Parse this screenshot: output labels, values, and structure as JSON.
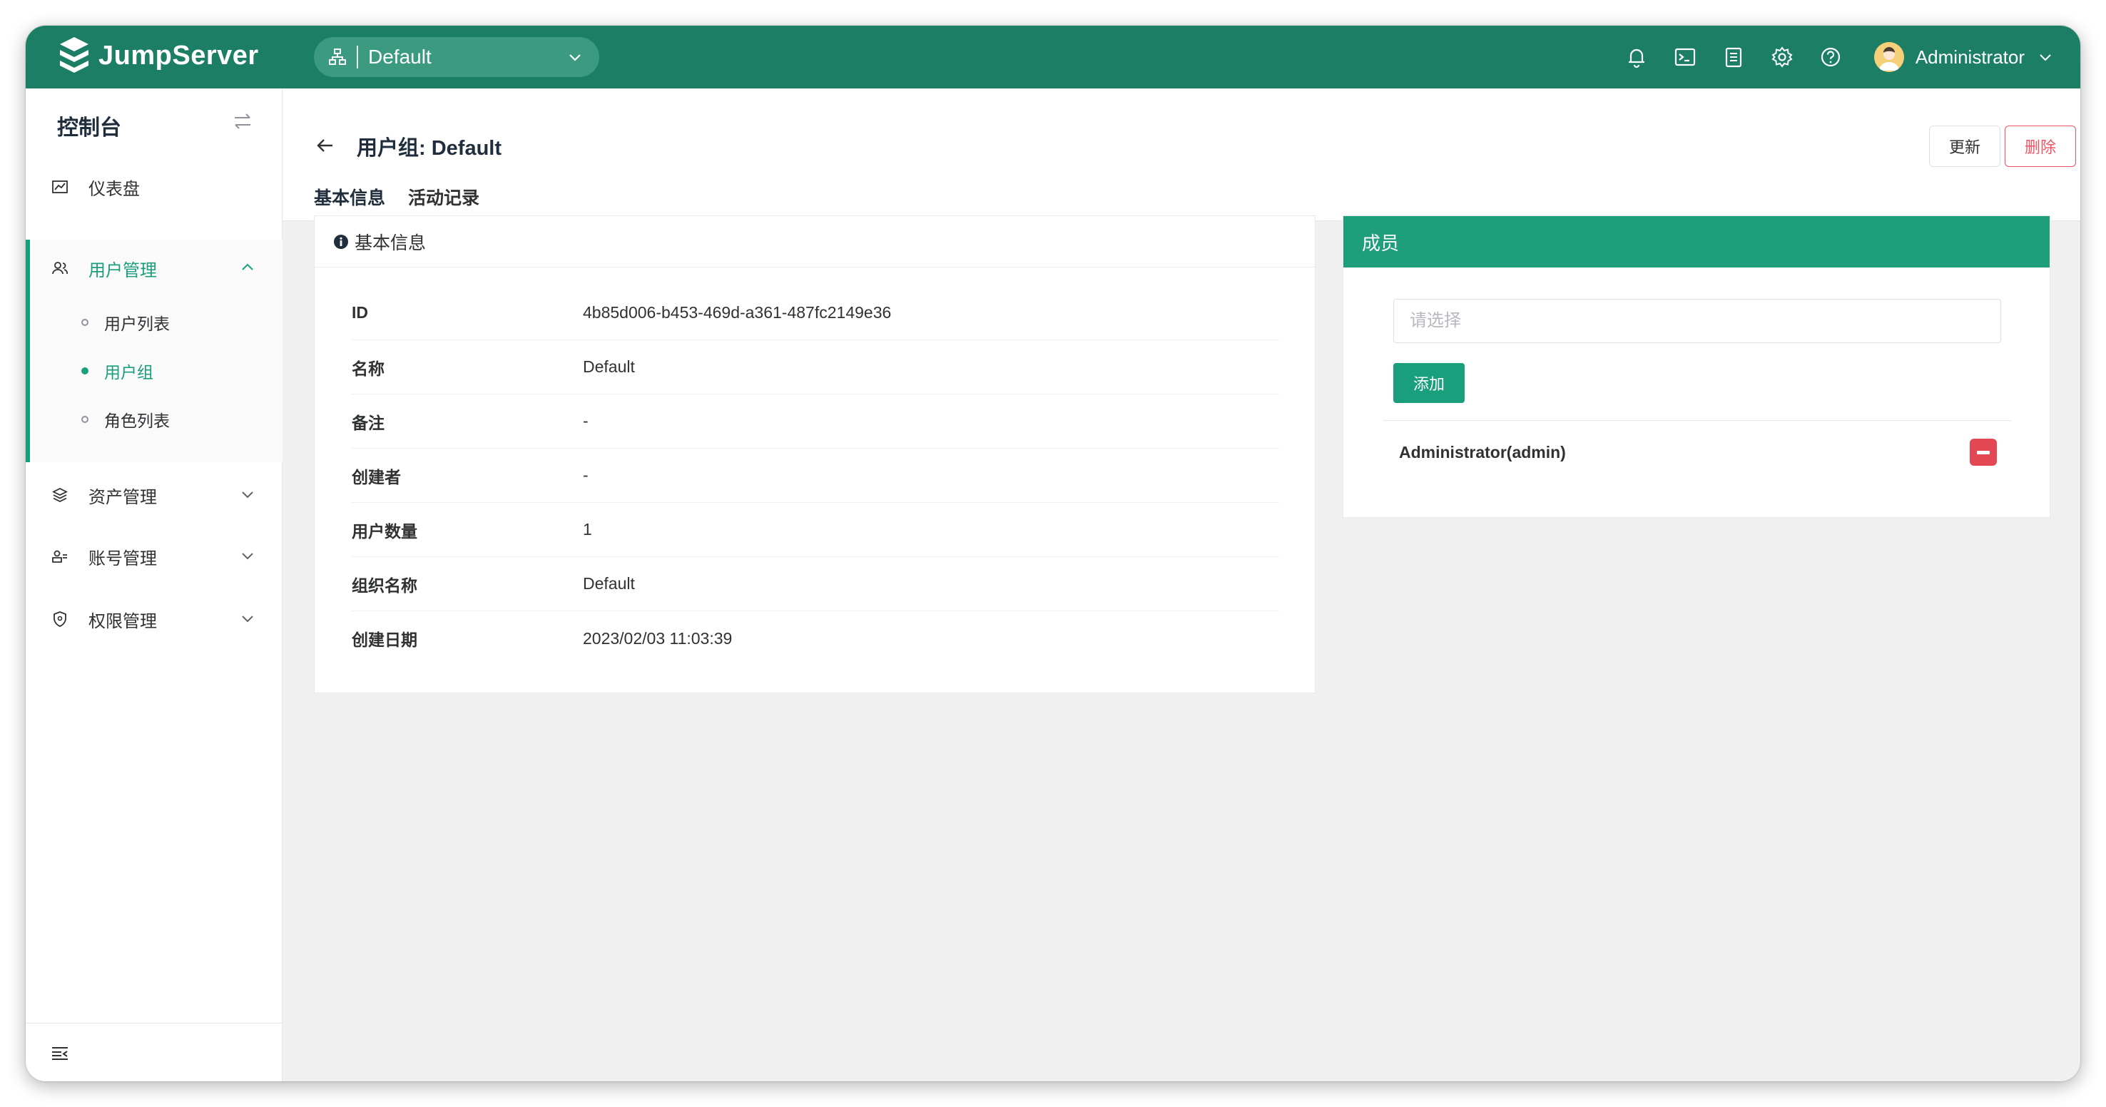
{
  "app": {
    "name": "JumpServer",
    "org_select": {
      "value": "Default"
    },
    "user": {
      "name": "Administrator"
    },
    "colors": {
      "primary": "#1c7f65",
      "accent": "#1a9f7c",
      "danger": "#ed5565"
    },
    "top_icons": [
      "bell-icon",
      "terminal-icon",
      "clipboard-icon",
      "gear-icon",
      "help-icon"
    ]
  },
  "sidebar": {
    "title": "控制台",
    "items": [
      {
        "label": "仪表盘",
        "icon": "dashboard-icon"
      },
      {
        "label": "用户管理",
        "icon": "users-icon",
        "expanded": true,
        "children": [
          {
            "label": "用户列表"
          },
          {
            "label": "用户组",
            "active": true
          },
          {
            "label": "角色列表"
          }
        ]
      },
      {
        "label": "资产管理",
        "icon": "layers-icon"
      },
      {
        "label": "账号管理",
        "icon": "account-icon"
      },
      {
        "label": "权限管理",
        "icon": "shield-icon"
      }
    ]
  },
  "page": {
    "title": "用户组: Default",
    "actions": {
      "update": "更新",
      "delete": "删除"
    },
    "tabs": [
      {
        "label": "基本信息",
        "active": true
      },
      {
        "label": "活动记录"
      }
    ]
  },
  "info_card": {
    "title": "基本信息",
    "rows": [
      {
        "label": "ID",
        "value": "4b85d006-b453-469d-a361-487fc2149e36"
      },
      {
        "label": "名称",
        "value": "Default"
      },
      {
        "label": "备注",
        "value": "-"
      },
      {
        "label": "创建者",
        "value": "-"
      },
      {
        "label": "用户数量",
        "value": "1"
      },
      {
        "label": "组织名称",
        "value": "Default"
      },
      {
        "label": "创建日期",
        "value": "2023/02/03 11:03:39"
      }
    ]
  },
  "members_card": {
    "title": "成员",
    "select_placeholder": "请选择",
    "add_label": "添加",
    "members": [
      {
        "name": "Administrator(admin)"
      }
    ]
  }
}
